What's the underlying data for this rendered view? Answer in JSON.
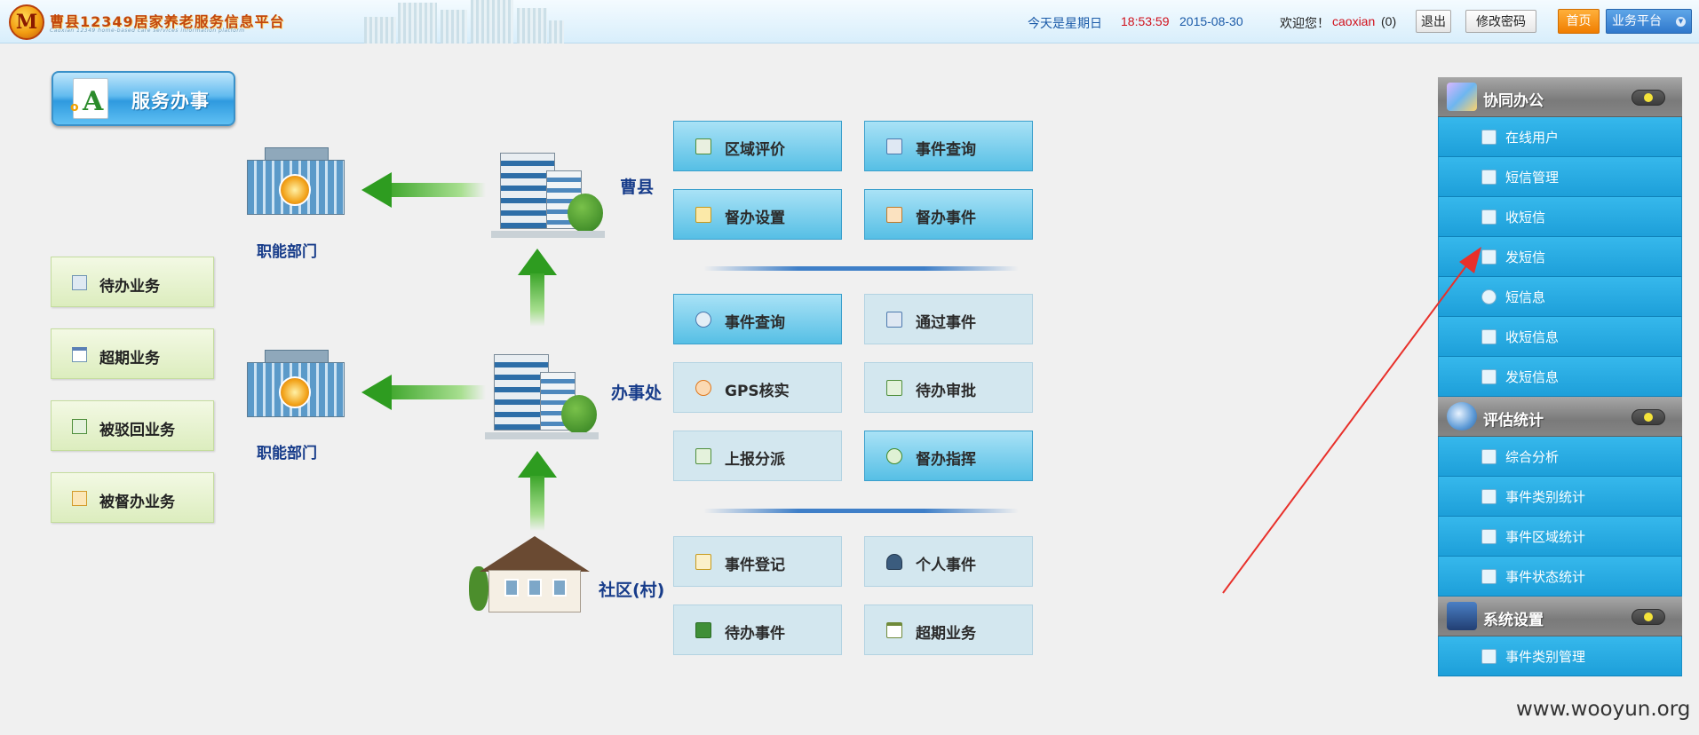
{
  "header": {
    "site_title": "曹县12349居家养老服务信息平台",
    "site_subtitle": "Caoxian 12349 home-based care services information platform",
    "date_prefix": "今天是星期日",
    "time": "18:53:59",
    "date": "2015-08-30",
    "welcome": "欢迎您！",
    "username": "caoxian",
    "message_count": "(0)",
    "logout_label": "退出",
    "change_password_label": "修改密码",
    "home_label": "首页",
    "platform_label": "业务平台"
  },
  "service": {
    "title": "服务办事"
  },
  "left_buttons": [
    {
      "label": "待办业务",
      "icon": "inbox-icon"
    },
    {
      "label": "超期业务",
      "icon": "calendar-icon"
    },
    {
      "label": "被驳回业务",
      "icon": "reject-icon"
    },
    {
      "label": "被督办业务",
      "icon": "supervise-icon"
    }
  ],
  "diagram": {
    "dept_label_1": "职能部门",
    "dept_label_2": "职能部门",
    "county_label": "曹县",
    "office_label": "办事处",
    "community_label": "社区(村)"
  },
  "function_buttons": {
    "county": [
      {
        "label": "区域评价",
        "icon": "evaluation-icon"
      },
      {
        "label": "事件查询",
        "icon": "home-query-icon"
      },
      {
        "label": "督办设置",
        "icon": "settings-icon"
      },
      {
        "label": "督办事件",
        "icon": "supervise-event-icon"
      }
    ],
    "office": [
      {
        "label": "事件查询",
        "icon": "search-icon"
      },
      {
        "label": "通过事件",
        "icon": "approved-icon"
      },
      {
        "label": "GPS核实",
        "icon": "gps-icon"
      },
      {
        "label": "待办审批",
        "icon": "pending-approval-icon"
      },
      {
        "label": "上报分派",
        "icon": "report-dispatch-icon"
      },
      {
        "label": "督办指挥",
        "icon": "command-icon"
      }
    ],
    "community": [
      {
        "label": "事件登记",
        "icon": "register-icon"
      },
      {
        "label": "个人事件",
        "icon": "person-icon"
      },
      {
        "label": "待办事件",
        "icon": "todo-icon"
      },
      {
        "label": "超期业务",
        "icon": "overdue-calendar-icon"
      }
    ]
  },
  "menu": {
    "sections": [
      {
        "title": "协同办公",
        "items": [
          "在线用户",
          "短信管理",
          "收短信",
          "发短信",
          "短信息",
          "收短信息",
          "发短信息"
        ]
      },
      {
        "title": "评估统计",
        "items": [
          "综合分析",
          "事件类别统计",
          "事件区域统计",
          "事件状态统计"
        ]
      },
      {
        "title": "系统设置",
        "items": [
          "事件类别管理"
        ]
      }
    ]
  },
  "watermark": "www.wooyun.org",
  "colors": {
    "accent_blue": "#1d9fd9",
    "header_time_red": "#d0101b",
    "label_navy": "#173c8a",
    "annotation_red": "#e8302a"
  }
}
